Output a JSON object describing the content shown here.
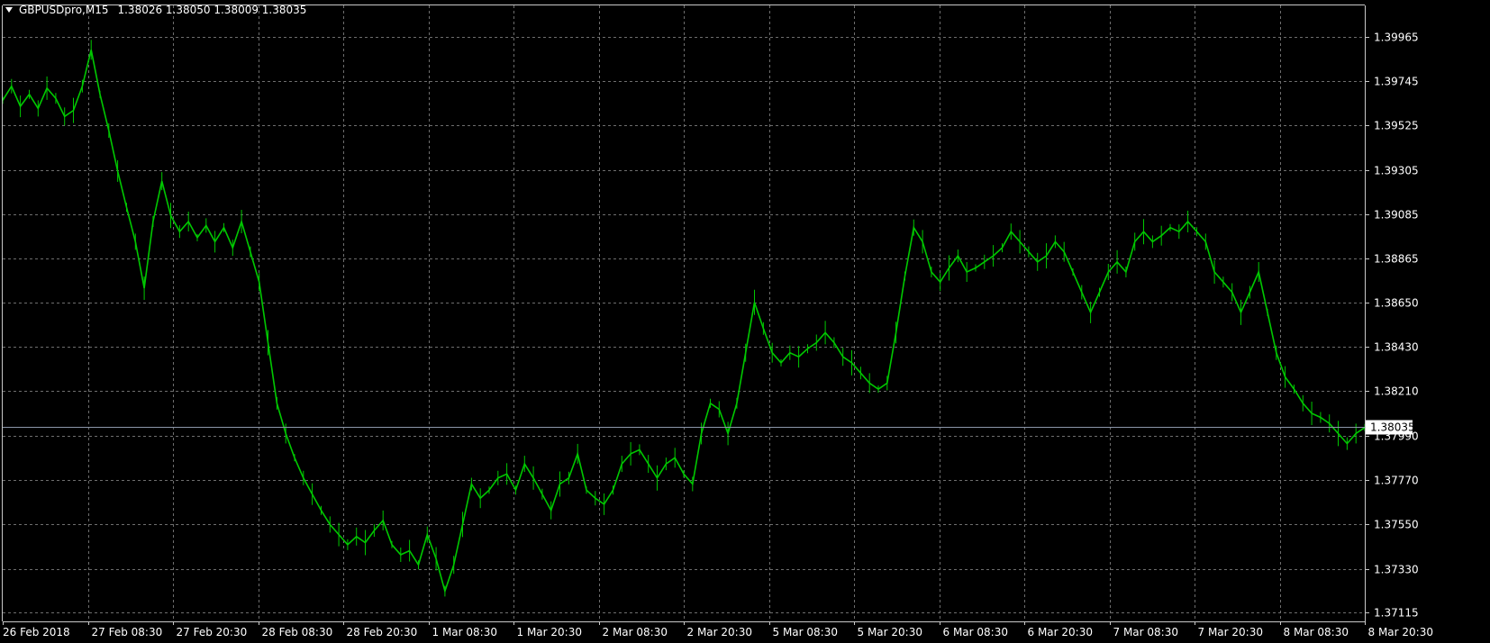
{
  "header": {
    "symbol_timeframe": "GBPUSDpro,M15",
    "ohlc": "1.38026 1.38050 1.38009 1.38035",
    "menu_icon": "triangle-down-icon"
  },
  "colors": {
    "background": "#000000",
    "grid": "#6e6e6e",
    "axis": "#c8c8c8",
    "series": "#00c800",
    "text": "#ffffff",
    "current_price_line": "#8c96aa",
    "current_price_box_bg": "#ffffff",
    "current_price_box_text": "#000000"
  },
  "current_price": 1.38035,
  "chart_data": {
    "type": "line",
    "title": "GBPUSDpro,M15",
    "y_ticks": [
      1.39965,
      1.39745,
      1.39525,
      1.39305,
      1.39085,
      1.38865,
      1.3865,
      1.3843,
      1.3821,
      1.3799,
      1.3777,
      1.3755,
      1.3733,
      1.37115
    ],
    "y_tick_labels": [
      "1.39965",
      "1.39745",
      "1.39525",
      "1.39305",
      "1.39085",
      "1.38865",
      "1.38650",
      "1.38430",
      "1.38210",
      "1.37990",
      "1.37770",
      "1.37550",
      "1.37330",
      "1.37115"
    ],
    "x_tick_labels": [
      "26 Feb 2018",
      "27 Feb 08:30",
      "27 Feb 20:30",
      "28 Feb 08:30",
      "28 Feb 20:30",
      "1 Mar 08:30",
      "1 Mar 20:30",
      "2 Mar 08:30",
      "2 Mar 20:30",
      "5 Mar 08:30",
      "5 Mar 20:30",
      "6 Mar 08:30",
      "6 Mar 20:30",
      "7 Mar 08:30",
      "7 Mar 20:30",
      "8 Mar 08:30",
      "8 Mar 20:30"
    ],
    "ylim": [
      1.3707,
      1.4012
    ],
    "grid": true,
    "series": [
      {
        "values": [
          1.3965,
          1.3972,
          1.3962,
          1.3968,
          1.3961,
          1.3971,
          1.3966,
          1.3957,
          1.396,
          1.3972,
          1.399,
          1.3968,
          1.395,
          1.393,
          1.3912,
          1.3895,
          1.3872,
          1.3905,
          1.3925,
          1.3908,
          1.39,
          1.3905,
          1.3897,
          1.3903,
          1.3895,
          1.3902,
          1.3892,
          1.3905,
          1.389,
          1.3875,
          1.3845,
          1.3815,
          1.38,
          1.3788,
          1.3778,
          1.377,
          1.3762,
          1.3755,
          1.375,
          1.3745,
          1.3749,
          1.3746,
          1.3752,
          1.3757,
          1.3745,
          1.374,
          1.3742,
          1.3735,
          1.375,
          1.3738,
          1.3722,
          1.3735,
          1.3755,
          1.3775,
          1.3768,
          1.3772,
          1.3778,
          1.378,
          1.3772,
          1.3785,
          1.3778,
          1.377,
          1.3762,
          1.3775,
          1.3778,
          1.379,
          1.3772,
          1.3768,
          1.3765,
          1.3772,
          1.3785,
          1.379,
          1.3792,
          1.3785,
          1.3778,
          1.3785,
          1.3788,
          1.378,
          1.3775,
          1.38,
          1.3815,
          1.3812,
          1.38,
          1.3815,
          1.384,
          1.3865,
          1.3852,
          1.384,
          1.3835,
          1.384,
          1.3838,
          1.3842,
          1.3845,
          1.385,
          1.3845,
          1.3838,
          1.3835,
          1.383,
          1.3825,
          1.3822,
          1.3825,
          1.385,
          1.3878,
          1.3902,
          1.3895,
          1.388,
          1.3875,
          1.3882,
          1.3888,
          1.388,
          1.3882,
          1.3885,
          1.3888,
          1.3892,
          1.39,
          1.3895,
          1.389,
          1.3885,
          1.3888,
          1.3895,
          1.389,
          1.388,
          1.387,
          1.386,
          1.387,
          1.388,
          1.3885,
          1.388,
          1.3895,
          1.39,
          1.3895,
          1.3898,
          1.3902,
          1.39,
          1.3905,
          1.39,
          1.3895,
          1.388,
          1.3875,
          1.387,
          1.386,
          1.387,
          1.388,
          1.386,
          1.384,
          1.3828,
          1.3822,
          1.3815,
          1.381,
          1.3808,
          1.3805,
          1.38,
          1.3795,
          1.38,
          1.3803
        ]
      }
    ]
  }
}
